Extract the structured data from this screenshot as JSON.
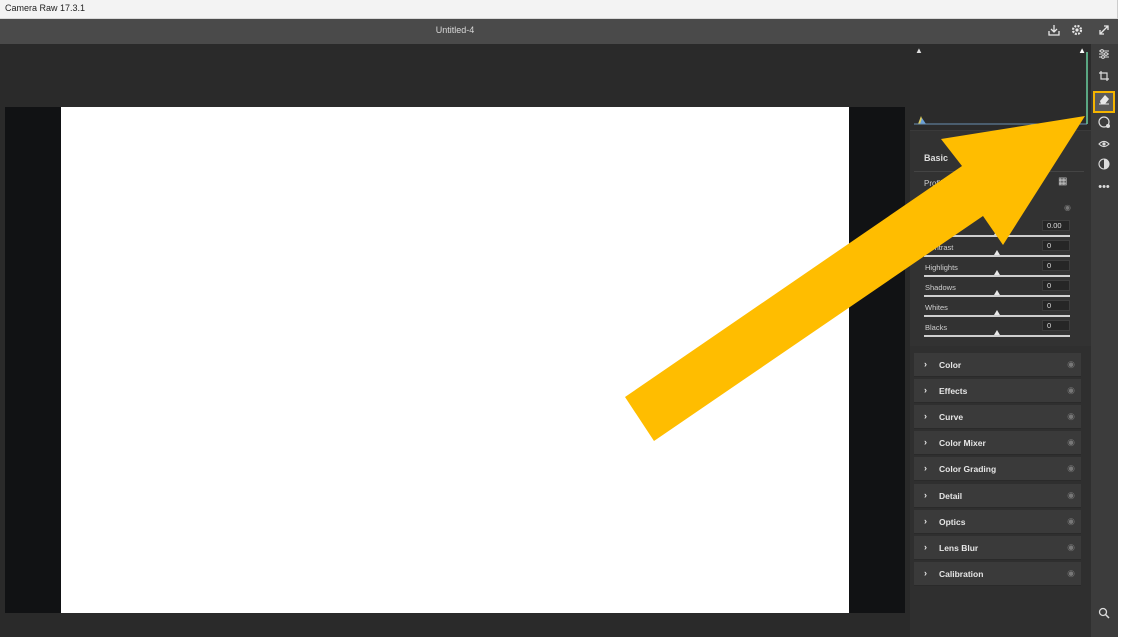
{
  "app": {
    "title": "Camera Raw 17.3.1",
    "document": "Untitled-4"
  },
  "topbar_icons": [
    "save-icon",
    "gear-icon",
    "expand-icon"
  ],
  "histogram": {
    "clip_left_glyph": "▲",
    "clip_right_glyph": "▲"
  },
  "basic_panel": {
    "title": "Basic",
    "profile_label": "Profile",
    "sliders": [
      {
        "label": "Exposure",
        "value": "0.00"
      },
      {
        "label": "Contrast",
        "value": "0"
      },
      {
        "label": "Highlights",
        "value": "0"
      },
      {
        "label": "Shadows",
        "value": "0"
      },
      {
        "label": "Whites",
        "value": "0"
      },
      {
        "label": "Blacks",
        "value": "0"
      }
    ]
  },
  "sections": [
    {
      "label": "Color"
    },
    {
      "label": "Effects"
    },
    {
      "label": "Curve"
    },
    {
      "label": "Color Mixer"
    },
    {
      "label": "Color Grading"
    },
    {
      "label": "Detail"
    },
    {
      "label": "Optics"
    },
    {
      "label": "Lens Blur"
    },
    {
      "label": "Calibration"
    }
  ],
  "tools": [
    "edit-icon",
    "crop-icon",
    "remove-icon",
    "masking-icon",
    "red-eye-icon",
    "presets-icon",
    "more-icon"
  ],
  "annotation": {
    "color": "#FFBD00"
  },
  "colors": {
    "panel_bg": "#2f2f2f",
    "accent_highlight": "#f4b400",
    "photo": "#ffffff"
  }
}
